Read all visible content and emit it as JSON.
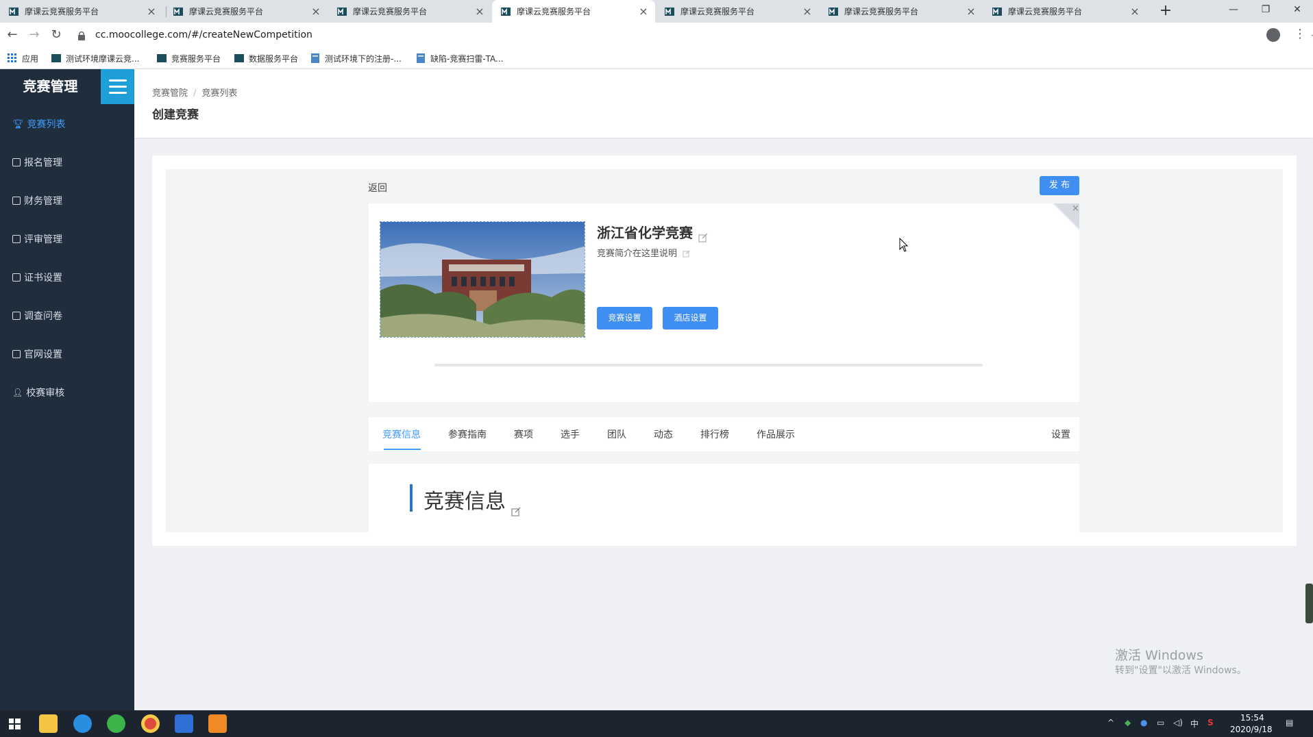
{
  "browser": {
    "tabs": [
      {
        "title": "摩课云竞赛服务平台"
      },
      {
        "title": "摩课云竞赛服务平台"
      },
      {
        "title": "摩课云竞赛服务平台"
      },
      {
        "title": "摩课云竞赛服务平台",
        "active": true
      },
      {
        "title": "摩课云竞赛服务平台"
      },
      {
        "title": "摩课云竞赛服务平台"
      },
      {
        "title": "摩课云竞赛服务平台"
      }
    ],
    "url": "cc.moocollege.com/#/createNewCompetition",
    "bookmarks": [
      "应用",
      "测试环境摩课云竞...",
      "竞赛服务平台",
      "数据服务平台",
      "测试环境下的注册-...",
      "缺陷-竞赛扫雷-TA..."
    ]
  },
  "app": {
    "logo": "竞赛管理",
    "menu": [
      "竞赛列表",
      "报名管理",
      "财务管理",
      "评审管理",
      "证书设置",
      "调查问卷",
      "官网设置",
      "校赛审核"
    ],
    "active_menu": "竞赛列表"
  },
  "header": {
    "breadcrumb": [
      "竞赛管院",
      "竞赛列表"
    ],
    "title": "创建竞赛"
  },
  "competition": {
    "back": "返回",
    "publish": "发 布",
    "name": "浙江省化学竞赛",
    "description": "竞赛简介在这里说明",
    "settings_button": "竞赛设置",
    "hotel_button": "酒店设置",
    "close_mark": "×"
  },
  "content_tabs": {
    "items": [
      "竞赛信息",
      "参赛指南",
      "赛项",
      "选手",
      "团队",
      "动态",
      "排行榜",
      "作品展示"
    ],
    "settings": "设置",
    "active": "竞赛信息"
  },
  "info_section": {
    "title": "竞赛信息"
  },
  "watermark": {
    "line1": "激活 Windows",
    "line2": "转到\"设置\"以激活 Windows。"
  },
  "taskbar": {
    "time": "15:54",
    "date": "2020/9/18",
    "ime": "中"
  },
  "colors": {
    "sidebar": "#1f2d3d",
    "accent": "#409eff",
    "button": "#3f8ef2"
  }
}
